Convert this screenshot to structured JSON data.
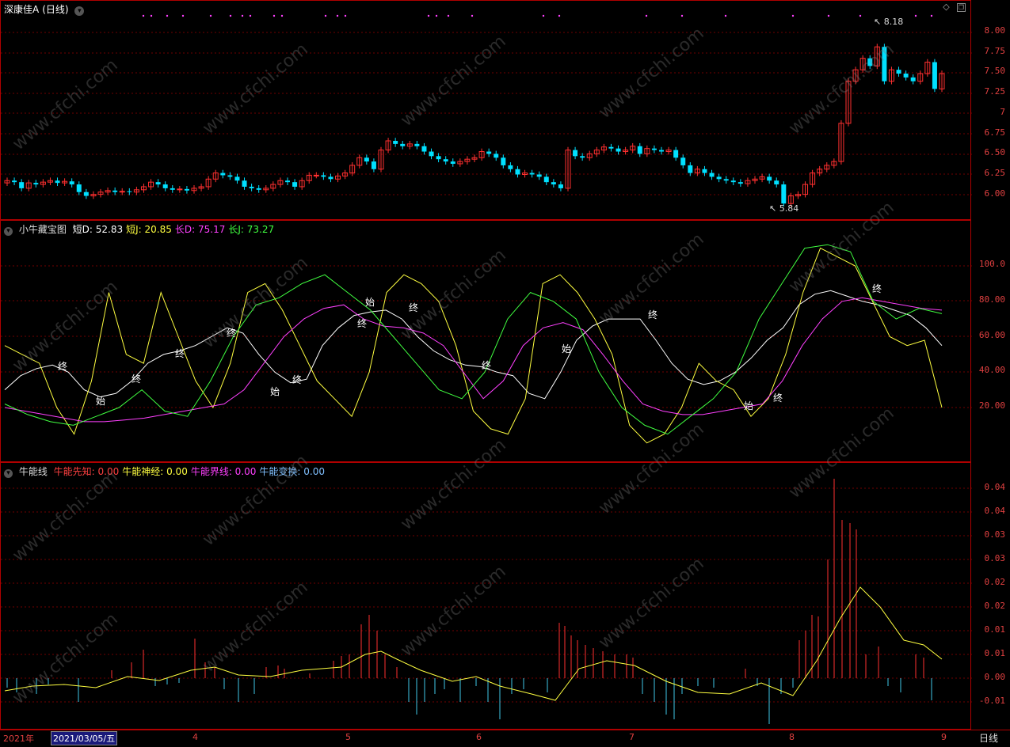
{
  "title": {
    "stock": "深康佳A",
    "period": "(日线)"
  },
  "colors": {
    "up": "#ff3030",
    "down": "#00e0ff",
    "grid": "#700000",
    "axis_text": "#e04040",
    "white": "#ffffff",
    "yellow": "#ffff40",
    "magenta": "#ff40ff",
    "green": "#40ff40"
  },
  "price_panel": {
    "ticks": [
      "8.00",
      "7.75",
      "7.50",
      "7.25",
      "7",
      "6.75",
      "6.50",
      "6.25",
      "6.00"
    ],
    "high_label": "8.18",
    "low_label": "5.84"
  },
  "kdj_panel": {
    "name": "小牛藏宝图",
    "items": [
      {
        "label": "短D:",
        "value": "52.83",
        "color": "#ffffff"
      },
      {
        "label": "短J:",
        "value": "20.85",
        "color": "#ffff40"
      },
      {
        "label": "长D:",
        "value": "75.17",
        "color": "#ff40ff"
      },
      {
        "label": "长J:",
        "value": "73.27",
        "color": "#40ff40"
      }
    ],
    "ticks": [
      "100.0",
      "80.00",
      "60.00",
      "40.00",
      "20.00"
    ],
    "markers": [
      {
        "text": "终"
      },
      {
        "text": "始"
      },
      {
        "text": "终"
      },
      {
        "text": "终"
      },
      {
        "text": "终"
      },
      {
        "text": "始"
      },
      {
        "text": "终"
      },
      {
        "text": "终"
      },
      {
        "text": "始"
      },
      {
        "text": "终"
      },
      {
        "text": "终"
      },
      {
        "text": "始"
      },
      {
        "text": "终"
      },
      {
        "text": "始"
      },
      {
        "text": "终"
      },
      {
        "text": "终"
      }
    ]
  },
  "energy_panel": {
    "name": "牛能线",
    "items": [
      {
        "label": "牛能先知:",
        "value": "0.00",
        "color": "#ff4040"
      },
      {
        "label": "牛能神经:",
        "value": "0.00",
        "color": "#ffff40"
      },
      {
        "label": "牛能界线:",
        "value": "0.00",
        "color": "#ff40ff"
      },
      {
        "label": "牛能变换:",
        "value": "0.00",
        "color": "#80c0ff"
      }
    ],
    "ticks": [
      "0.04",
      "0.04",
      "0.03",
      "0.03",
      "0.02",
      "0.02",
      "0.01",
      "0.01",
      "0.00",
      "-0.01"
    ]
  },
  "x_axis": {
    "labels": [
      "2021年",
      "4",
      "5",
      "6",
      "7",
      "8",
      "9"
    ],
    "cursor_date": "2021/03/05/五",
    "period_label": "日线"
  },
  "watermark": "www.cfchi.com",
  "chart_data": [
    {
      "type": "candlestick",
      "title": "深康佳A (日线)",
      "ylim": [
        5.84,
        8.18
      ],
      "high": 8.18,
      "low": 5.84,
      "close": [
        6.2,
        6.18,
        6.1,
        6.17,
        6.15,
        6.18,
        6.2,
        6.17,
        6.19,
        6.15,
        6.05,
        6.0,
        6.02,
        6.05,
        6.07,
        6.05,
        6.06,
        6.05,
        6.08,
        6.12,
        6.18,
        6.15,
        6.1,
        6.08,
        6.09,
        6.07,
        6.1,
        6.12,
        6.22,
        6.3,
        6.27,
        6.25,
        6.2,
        6.12,
        6.1,
        6.08,
        6.1,
        6.15,
        6.2,
        6.18,
        6.12,
        6.2,
        6.27,
        6.27,
        6.25,
        6.22,
        6.26,
        6.3,
        6.4,
        6.5,
        6.45,
        6.35,
        6.6,
        6.72,
        6.68,
        6.65,
        6.68,
        6.65,
        6.58,
        6.52,
        6.48,
        6.45,
        6.42,
        6.45,
        6.48,
        6.5,
        6.58,
        6.55,
        6.5,
        6.4,
        6.35,
        6.28,
        6.3,
        6.28,
        6.25,
        6.18,
        6.15,
        6.1,
        6.6,
        6.52,
        6.5,
        6.55,
        6.6,
        6.64,
        6.62,
        6.58,
        6.6,
        6.65,
        6.55,
        6.62,
        6.6,
        6.58,
        6.6,
        6.5,
        6.4,
        6.3,
        6.35,
        6.3,
        6.25,
        6.22,
        6.2,
        6.18,
        6.16,
        6.2,
        6.22,
        6.25,
        6.2,
        6.15,
        5.9,
        6.0,
        6.02,
        6.15,
        6.3,
        6.35,
        6.4,
        6.45,
        6.95,
        7.5,
        7.65,
        7.8,
        7.7,
        7.95,
        7.5,
        7.65,
        7.6,
        7.55,
        7.5,
        7.6,
        7.75,
        7.4,
        7.6
      ],
      "last_price_tick": "7.50"
    },
    {
      "type": "line",
      "title": "小牛藏宝图",
      "ylim": [
        0,
        120
      ],
      "series": [
        {
          "name": "短D",
          "last": 52.83,
          "values": [
            30,
            38,
            42,
            44,
            40,
            30,
            26,
            28,
            35,
            45,
            50,
            52,
            55,
            60,
            65,
            62,
            50,
            40,
            34,
            36,
            55,
            65,
            72,
            74,
            75,
            70,
            60,
            52,
            47,
            44,
            43,
            40,
            38,
            28,
            25,
            40,
            58,
            66,
            70,
            70,
            70,
            58,
            45,
            36,
            33,
            35,
            40,
            48,
            58,
            65,
            78,
            84,
            86,
            83,
            80,
            78,
            75,
            72,
            65,
            55
          ]
        },
        {
          "name": "短J",
          "last": 20.85,
          "values": [
            55,
            50,
            45,
            20,
            5,
            35,
            85,
            50,
            45,
            85,
            60,
            35,
            20,
            45,
            85,
            90,
            75,
            55,
            35,
            25,
            15,
            40,
            85,
            95,
            90,
            80,
            55,
            18,
            8,
            5,
            25,
            90,
            95,
            85,
            70,
            50,
            10,
            0,
            5,
            20,
            45,
            35,
            30,
            15,
            25,
            50,
            85,
            110,
            105,
            100,
            80,
            60,
            55,
            58,
            20
          ]
        },
        {
          "name": "长D",
          "last": 75.17,
          "values": [
            20,
            18,
            16,
            14,
            12,
            12,
            13,
            14,
            16,
            18,
            20,
            22,
            30,
            45,
            60,
            70,
            76,
            78,
            70,
            66,
            65,
            62,
            55,
            40,
            25,
            35,
            55,
            65,
            68,
            64,
            50,
            35,
            22,
            18,
            16,
            16,
            18,
            20,
            22,
            35,
            55,
            70,
            80,
            82,
            80,
            78,
            76,
            75
          ]
        },
        {
          "name": "长J",
          "last": 73.27,
          "values": [
            22,
            16,
            12,
            10,
            15,
            20,
            30,
            18,
            15,
            35,
            60,
            78,
            82,
            90,
            95,
            85,
            75,
            60,
            45,
            30,
            25,
            40,
            70,
            85,
            80,
            70,
            40,
            20,
            10,
            5,
            15,
            25,
            40,
            70,
            90,
            110,
            112,
            108,
            80,
            70,
            76,
            73
          ]
        }
      ]
    },
    {
      "type": "bar",
      "title": "牛能线",
      "ylim": [
        -0.015,
        0.045
      ],
      "series": [
        {
          "name": "牛能先知",
          "values": [
            0.0
          ]
        },
        {
          "name": "牛能神经",
          "values": [
            0.0
          ]
        },
        {
          "name": "牛能界线",
          "values": [
            0.0
          ]
        },
        {
          "name": "牛能变换",
          "values": [
            0.0
          ]
        }
      ]
    }
  ]
}
